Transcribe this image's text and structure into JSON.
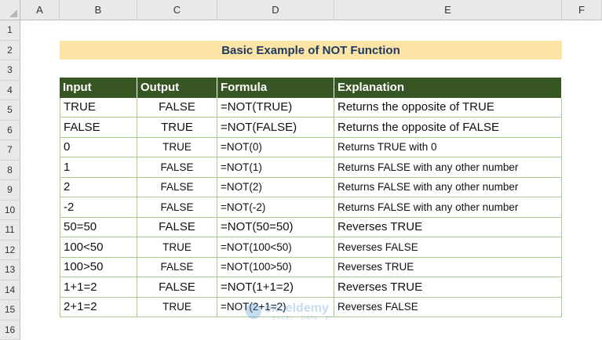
{
  "columns": [
    "A",
    "B",
    "C",
    "D",
    "E",
    "F"
  ],
  "rows": [
    "1",
    "2",
    "3",
    "4",
    "5",
    "6",
    "7",
    "8",
    "9",
    "10",
    "11",
    "12",
    "13",
    "14",
    "15",
    "16"
  ],
  "title": "Basic Example of NOT Function",
  "table": {
    "headers": [
      "Input",
      "Output",
      "Formula",
      "Explanation"
    ],
    "rows": [
      {
        "input": "TRUE",
        "output": "FALSE",
        "formula": "=NOT(TRUE)",
        "explanation": "Returns the opposite of TRUE",
        "size": "large"
      },
      {
        "input": "FALSE",
        "output": "TRUE",
        "formula": "=NOT(FALSE)",
        "explanation": "Returns the opposite of FALSE",
        "size": "large"
      },
      {
        "input": "0",
        "output": "TRUE",
        "formula": "=NOT(0)",
        "explanation": "Returns TRUE with 0",
        "size": "small"
      },
      {
        "input": "1",
        "output": "FALSE",
        "formula": "=NOT(1)",
        "explanation": "Returns FALSE with any other number",
        "size": "small"
      },
      {
        "input": "2",
        "output": "FALSE",
        "formula": "=NOT(2)",
        "explanation": "Returns FALSE with any other number",
        "size": "small"
      },
      {
        "input": "-2",
        "output": "FALSE",
        "formula": "=NOT(-2)",
        "explanation": "Returns FALSE with any other number",
        "size": "small"
      },
      {
        "input": "50=50",
        "output": "FALSE",
        "formula": "=NOT(50=50)",
        "explanation": "Reverses TRUE",
        "size": "large"
      },
      {
        "input": "100<50",
        "output": "TRUE",
        "formula": "=NOT(100<50)",
        "explanation": "Reverses FALSE",
        "size": "small"
      },
      {
        "input": "100>50",
        "output": "FALSE",
        "formula": "=NOT(100>50)",
        "explanation": "Reverses TRUE",
        "size": "small"
      },
      {
        "input": "1+1=2",
        "output": "FALSE",
        "formula": "=NOT(1+1=2)",
        "explanation": "Reverses TRUE",
        "size": "large"
      },
      {
        "input": "2+1=2",
        "output": "TRUE",
        "formula": "=NOT(2+1=2)",
        "explanation": "Reverses FALSE",
        "size": "small"
      }
    ]
  },
  "watermark": {
    "brand": "exceldemy",
    "tagline": "EXCEL · DATA · BI"
  },
  "colors": {
    "title_bg": "#fce4a4",
    "title_text": "#1f3864",
    "header_bg": "#375623",
    "grid": "#a9c98f"
  }
}
